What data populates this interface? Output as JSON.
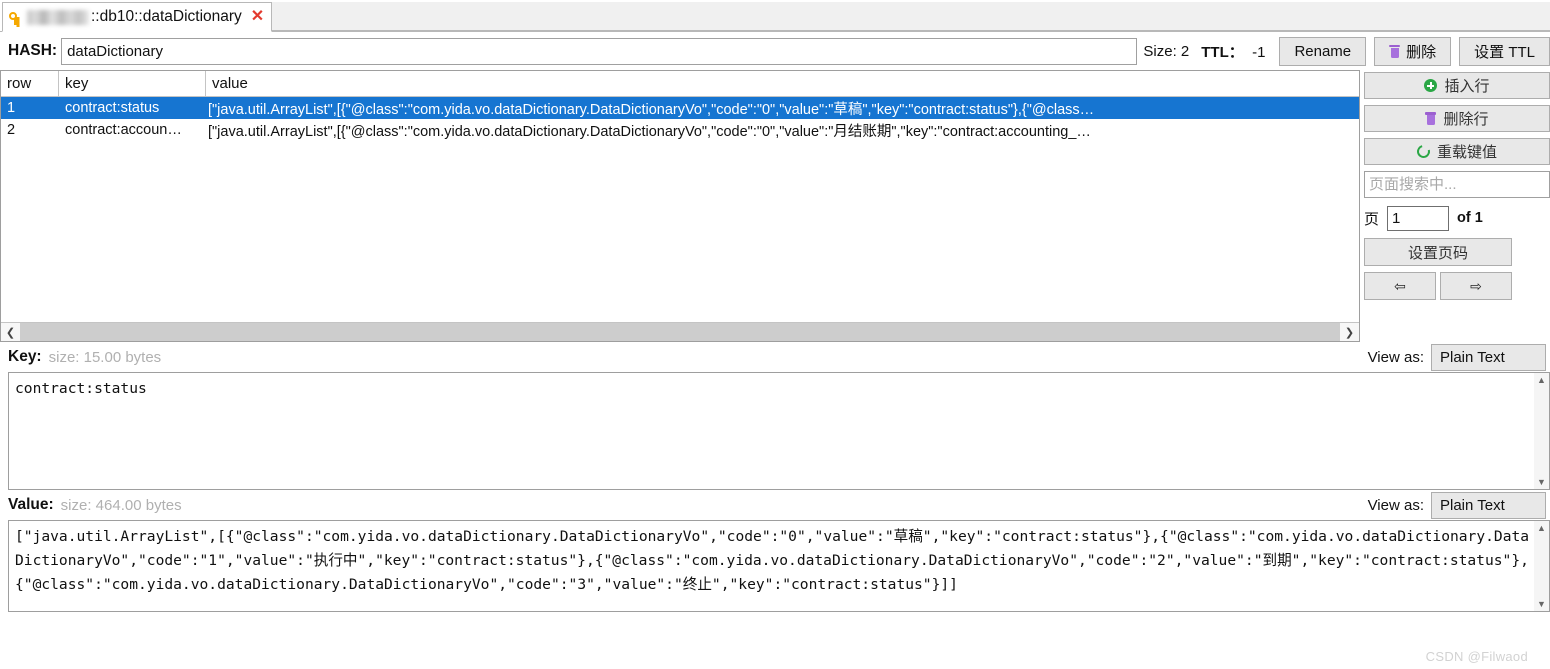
{
  "tab": {
    "icon": "key-icon",
    "title": "::db10::dataDictionary",
    "close_label": "✕"
  },
  "toolbar": {
    "hash_label": "HASH:",
    "hash_value": "dataDictionary",
    "size_text": "Size: 2",
    "ttl_label": "TTL：",
    "ttl_value": "-1",
    "rename_label": "Rename",
    "delete_label": "删除",
    "set_ttl_label": "设置 TTL"
  },
  "table": {
    "headers": [
      "row",
      "key",
      "value"
    ],
    "rows": [
      {
        "row": "1",
        "key": "contract:status",
        "value": "[\"java.util.ArrayList\",[{\"@class\":\"com.yida.vo.dataDictionary.DataDictionaryVo\",\"code\":\"0\",\"value\":\"草稿\",\"key\":\"contract:status\"},{\"@class…",
        "selected": true
      },
      {
        "row": "2",
        "key": "contract:accoun…",
        "value": "[\"java.util.ArrayList\",[{\"@class\":\"com.yida.vo.dataDictionary.DataDictionaryVo\",\"code\":\"0\",\"value\":\"月结账期\",\"key\":\"contract:accounting_…",
        "selected": false
      }
    ]
  },
  "sidebar": {
    "insert_row_label": "插入行",
    "delete_row_label": "删除行",
    "reload_label": "重载键值",
    "search_placeholder": "页面搜索中...",
    "search_value": "",
    "page_label": "页",
    "page_value": "1",
    "page_of": "of 1",
    "set_page_label": "设置页码",
    "prev_label": "⇦",
    "next_label": "⇨"
  },
  "key_pane": {
    "label": "Key:",
    "size": "size: 15.00 bytes",
    "view_as_label": "View as:",
    "view_as_value": "Plain Text",
    "content": "contract:status"
  },
  "value_pane": {
    "label": "Value:",
    "size": "size: 464.00 bytes",
    "view_as_label": "View as:",
    "view_as_value": "Plain Text",
    "content": "[\"java.util.ArrayList\",[{\"@class\":\"com.yida.vo.dataDictionary.DataDictionaryVo\",\"code\":\"0\",\"value\":\"草稿\",\"key\":\"contract:status\"},{\"@class\":\"com.yida.vo.dataDictionary.DataDictionaryVo\",\"code\":\"1\",\"value\":\"执行中\",\"key\":\"contract:status\"},{\"@class\":\"com.yida.vo.dataDictionary.DataDictionaryVo\",\"code\":\"2\",\"value\":\"到期\",\"key\":\"contract:status\"},{\"@class\":\"com.yida.vo.dataDictionary.DataDictionaryVo\",\"code\":\"3\",\"value\":\"终止\",\"key\":\"contract:status\"}]]"
  },
  "watermark": "CSDN @Filwaod",
  "colors": {
    "selection_blue": "#1675d1",
    "close_red": "#e33a2e",
    "key_gold": "#f5a800",
    "trash_purple": "#a770dd",
    "green": "#2aa745"
  }
}
